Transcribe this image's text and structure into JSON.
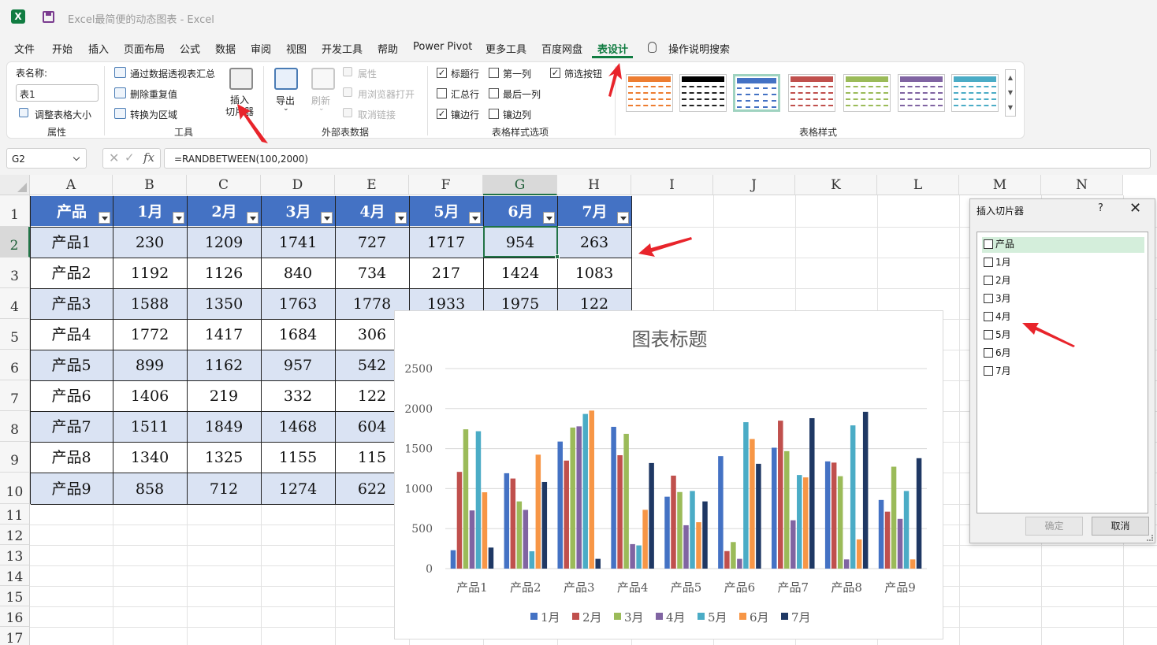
{
  "window": {
    "title": "Excel最简便的动态图表 - Excel",
    "logo": "X"
  },
  "menu": [
    "文件",
    "开始",
    "插入",
    "页面布局",
    "公式",
    "数据",
    "审阅",
    "视图",
    "开发工具",
    "帮助",
    "Power Pivot",
    "更多工具",
    "百度网盘",
    "表设计",
    "操作说明搜索"
  ],
  "menu_active": "表设计",
  "ribbon": {
    "props": {
      "name_label": "表名称:",
      "name_value": "表1",
      "resize": "调整表格大小",
      "group": "属性"
    },
    "tools": {
      "pivot": "通过数据透视表汇总",
      "dedupe": "删除重复值",
      "convert": "转换为区域",
      "slicer_l1": "插入",
      "slicer_l2": "切片器",
      "group": "工具"
    },
    "external": {
      "export": "导出",
      "refresh": "刷新",
      "properties": "属性",
      "browser": "用浏览器打开",
      "unlink": "取消链接",
      "group": "外部表数据"
    },
    "options": {
      "header_row": "标题行",
      "total_row": "汇总行",
      "banded_rows": "镶边行",
      "first_col": "第一列",
      "last_col": "最后一列",
      "banded_cols": "镶边列",
      "filter_btn": "筛选按钮",
      "group": "表格样式选项"
    },
    "styles_group": "表格样式",
    "style_colors": [
      "#ed7d31",
      "#000000",
      "#4472c4",
      "#c0504d",
      "#9bbb59",
      "#8064a2",
      "#4bacc6"
    ]
  },
  "formula": {
    "cell": "G2",
    "content": "=RANDBETWEEN(100,2000)",
    "fx": "fx"
  },
  "columns": [
    "A",
    "B",
    "C",
    "D",
    "E",
    "F",
    "G",
    "H",
    "I",
    "J",
    "K",
    "L",
    "M",
    "N"
  ],
  "rows": [
    "1",
    "2",
    "3",
    "4",
    "5",
    "6",
    "7",
    "8",
    "9",
    "10",
    "11",
    "12",
    "13",
    "14",
    "15",
    "16",
    "17"
  ],
  "table": {
    "headers": [
      "产品",
      "1月",
      "2月",
      "3月",
      "4月",
      "5月",
      "6月",
      "7月"
    ],
    "rows": [
      [
        "产品1",
        "230",
        "1209",
        "1741",
        "727",
        "1717",
        "954",
        "263"
      ],
      [
        "产品2",
        "1192",
        "1126",
        "840",
        "734",
        "217",
        "1424",
        "1083"
      ],
      [
        "产品3",
        "1588",
        "1350",
        "1763",
        "1778",
        "1933",
        "1975",
        "122"
      ],
      [
        "产品4",
        "1772",
        "1417",
        "1684",
        "306",
        "",
        "",
        ""
      ],
      [
        "产品5",
        "899",
        "1162",
        "957",
        "542",
        "",
        "",
        ""
      ],
      [
        "产品6",
        "1406",
        "219",
        "332",
        "122",
        "",
        "",
        ""
      ],
      [
        "产品7",
        "1511",
        "1849",
        "1468",
        "604",
        "",
        "",
        ""
      ],
      [
        "产品8",
        "1340",
        "1325",
        "1155",
        "115",
        "",
        "",
        ""
      ],
      [
        "产品9",
        "858",
        "712",
        "1274",
        "622",
        "",
        "",
        ""
      ]
    ]
  },
  "chart_data": {
    "type": "bar",
    "title": "图表标题",
    "categories": [
      "产品1",
      "产品2",
      "产品3",
      "产品4",
      "产品5",
      "产品6",
      "产品7",
      "产品8",
      "产品9"
    ],
    "ylim": [
      0,
      2500
    ],
    "yticks": [
      "0",
      "500",
      "1000",
      "1500",
      "2000",
      "2500"
    ],
    "grid": true,
    "legend": "bottom",
    "series": [
      {
        "name": "1月",
        "color": "#4472c4",
        "values": [
          230,
          1192,
          1588,
          1772,
          899,
          1406,
          1511,
          1340,
          858
        ]
      },
      {
        "name": "2月",
        "color": "#c0504d",
        "values": [
          1209,
          1126,
          1350,
          1417,
          1162,
          219,
          1849,
          1325,
          712
        ]
      },
      {
        "name": "3月",
        "color": "#9bbb59",
        "values": [
          1741,
          840,
          1763,
          1684,
          957,
          332,
          1468,
          1155,
          1274
        ]
      },
      {
        "name": "4月",
        "color": "#8064a2",
        "values": [
          727,
          734,
          1778,
          306,
          542,
          122,
          604,
          115,
          622
        ]
      },
      {
        "name": "5月",
        "color": "#4bacc6",
        "values": [
          1717,
          217,
          1933,
          290,
          970,
          1830,
          1170,
          1790,
          970
        ]
      },
      {
        "name": "6月",
        "color": "#f79646",
        "values": [
          954,
          1424,
          1975,
          735,
          580,
          1620,
          1140,
          365,
          115
        ]
      },
      {
        "name": "7月",
        "color": "#1f3864",
        "values": [
          263,
          1083,
          122,
          1320,
          840,
          1310,
          1880,
          1960,
          1380
        ]
      }
    ]
  },
  "dialog": {
    "title": "插入切片器",
    "help": "?",
    "close": "✕",
    "items": [
      "产品",
      "1月",
      "2月",
      "3月",
      "4月",
      "5月",
      "6月",
      "7月"
    ],
    "ok": "确定",
    "cancel": "取消"
  }
}
